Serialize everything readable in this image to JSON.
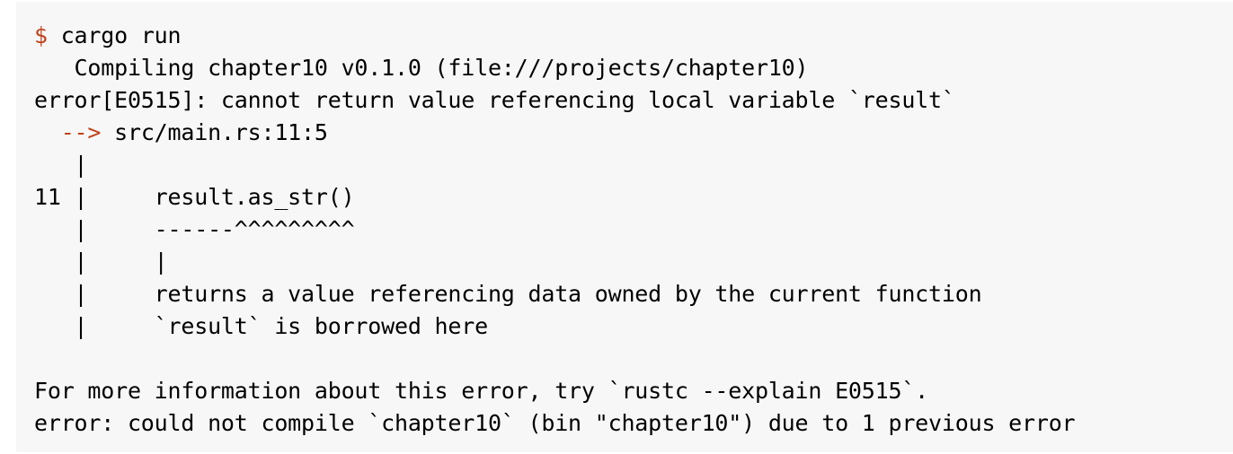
{
  "terminal": {
    "prompt_symbol": "$",
    "command": " cargo run",
    "compiling": "   Compiling chapter10 v0.1.0 (file:///projects/chapter10)",
    "error_header": "error[E0515]: cannot return value referencing local variable `result`",
    "arrow_indent": "  ",
    "arrow": "-->",
    "location": " src/main.rs:11:5",
    "gutter_1": "   |",
    "code_line": "11 |     result.as_str()",
    "underline": "   |     ------^^^^^^^^^",
    "pipe_line": "   |     |",
    "note_1": "   |     returns a value referencing data owned by the current function",
    "note_2": "   |     `result` is borrowed here",
    "blank": "",
    "more_info": "For more information about this error, try `rustc --explain E0515`.",
    "final_error": "error: could not compile `chapter10` (bin \"chapter10\") due to 1 previous error"
  },
  "colors": {
    "prompt": "#c0411b",
    "arrow": "#c0411b",
    "background": "#f6f7f6"
  }
}
